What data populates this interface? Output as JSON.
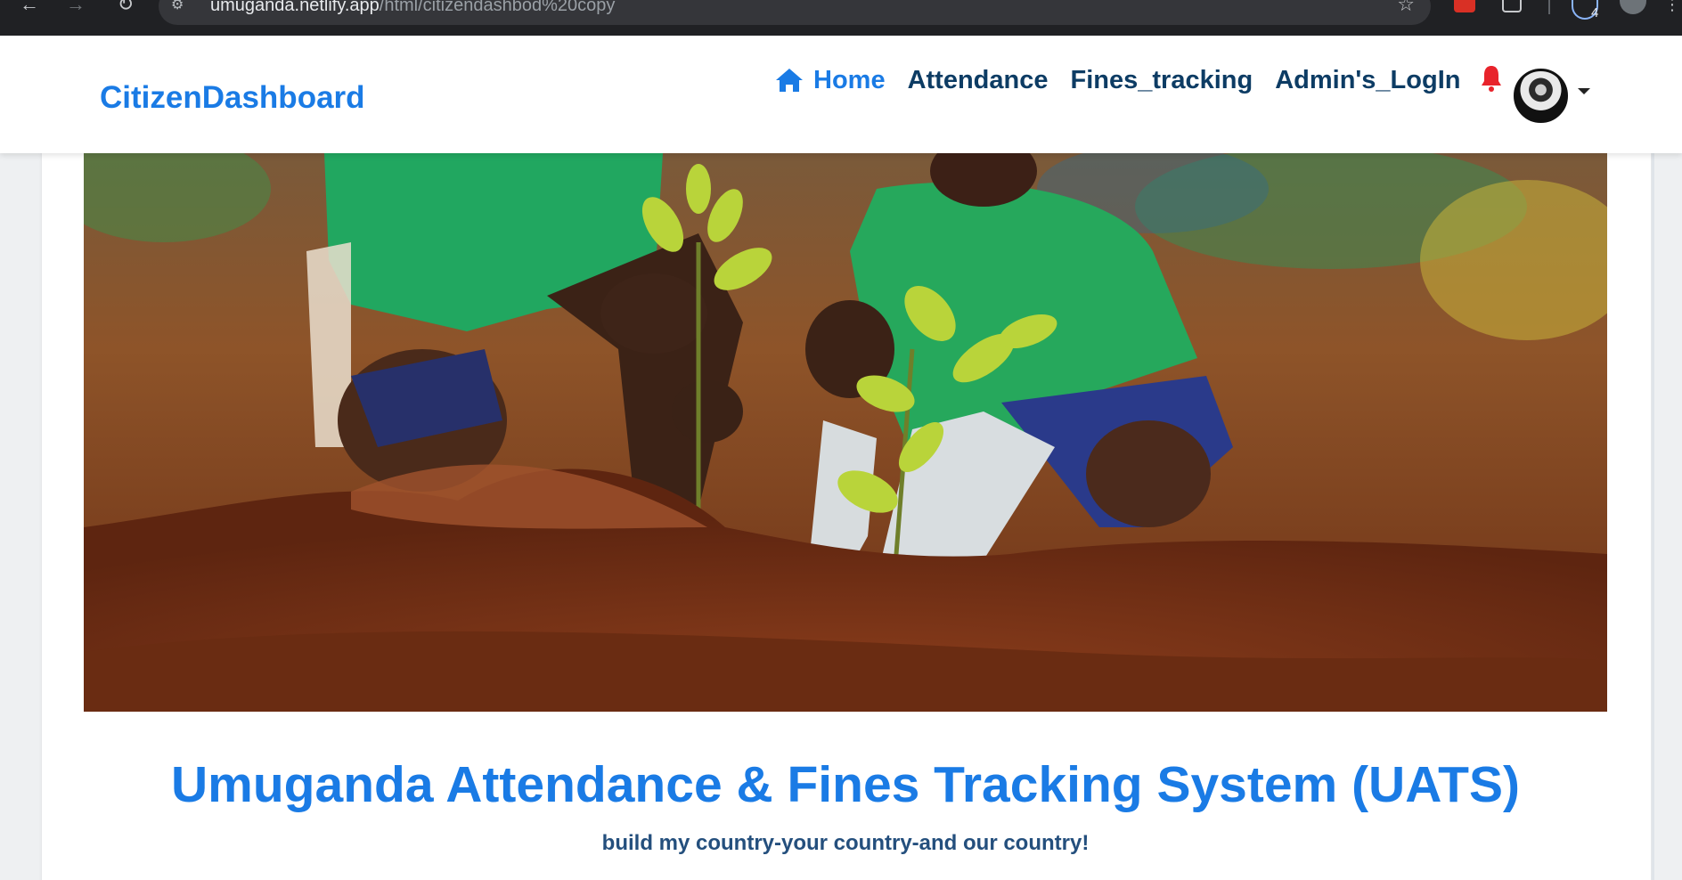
{
  "browser": {
    "url_host": "umuganda.netlify.app",
    "url_path": "/html/citizendashbod%20copy",
    "download_count": "4"
  },
  "navbar": {
    "brand": "CitizenDashboard",
    "links": [
      {
        "label": "Home",
        "active": true
      },
      {
        "label": "Attendance"
      },
      {
        "label": "Fines_tracking"
      },
      {
        "label": "Admin's_LogIn"
      }
    ]
  },
  "hero": {
    "icons": [
      "home-icon",
      "bell-icon",
      "avatar"
    ]
  },
  "main": {
    "title": "Umuganda Attendance & Fines Tracking System (UATS)",
    "tagline": "build my country-your country-and our country!"
  },
  "colors": {
    "brand_blue": "#1a7be5",
    "nav_dark": "#0d3c64",
    "bell_red": "#e8232b"
  }
}
